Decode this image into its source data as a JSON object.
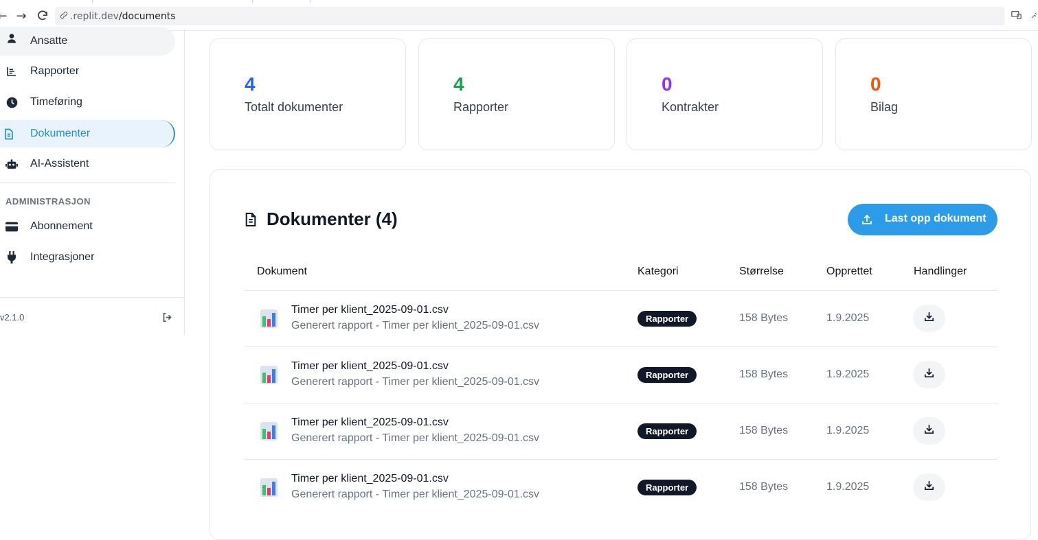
{
  "browser": {
    "url_host": ".replit.dev",
    "url_path": "/documents"
  },
  "sidebar": {
    "items": [
      {
        "label": "Ansatte",
        "icon": "person-icon"
      },
      {
        "label": "Rapporter",
        "icon": "chart-icon"
      },
      {
        "label": "Timeføring",
        "icon": "clock-icon"
      },
      {
        "label": "Dokumenter",
        "icon": "document-icon",
        "active": true
      },
      {
        "label": "AI-Assistent",
        "icon": "robot-icon"
      }
    ],
    "admin_section_title": "ADMINISTRASJON",
    "admin_items": [
      {
        "label": "Abonnement",
        "icon": "credit-card-icon"
      },
      {
        "label": "Integrasjoner",
        "icon": "plug-icon"
      }
    ],
    "version": "v2.1.0"
  },
  "stats": [
    {
      "value": "4",
      "label": "Totalt dokumenter",
      "color": "#2563eb"
    },
    {
      "value": "4",
      "label": "Rapporter",
      "color": "#16a34a"
    },
    {
      "value": "0",
      "label": "Kontrakter",
      "color": "#9333ea"
    },
    {
      "value": "0",
      "label": "Bilag",
      "color": "#ea580c"
    }
  ],
  "documents": {
    "title": "Dokumenter (4)",
    "upload_label": "Last opp dokument",
    "columns": [
      "Dokument",
      "Kategori",
      "Størrelse",
      "Opprettet",
      "Handlinger"
    ],
    "rows": [
      {
        "name": "Timer per klient_2025-09-01.csv",
        "description": "Generert rapport - Timer per klient_2025-09-01.csv",
        "category": "Rapporter",
        "size": "158 Bytes",
        "created": "1.9.2025"
      },
      {
        "name": "Timer per klient_2025-09-01.csv",
        "description": "Generert rapport - Timer per klient_2025-09-01.csv",
        "category": "Rapporter",
        "size": "158 Bytes",
        "created": "1.9.2025"
      },
      {
        "name": "Timer per klient_2025-09-01.csv",
        "description": "Generert rapport - Timer per klient_2025-09-01.csv",
        "category": "Rapporter",
        "size": "158 Bytes",
        "created": "1.9.2025"
      },
      {
        "name": "Timer per klient_2025-09-01.csv",
        "description": "Generert rapport - Timer per klient_2025-09-01.csv",
        "category": "Rapporter",
        "size": "158 Bytes",
        "created": "1.9.2025"
      }
    ]
  },
  "colors": {
    "accent": "#2d9ce8",
    "active_nav_bg": "#e8f3fd",
    "badge_bg": "#111827"
  }
}
